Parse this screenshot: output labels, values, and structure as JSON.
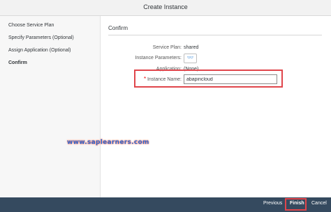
{
  "window": {
    "title": "Create Instance",
    "top_glyph": "¨"
  },
  "sidebar": {
    "steps": [
      {
        "label": "Choose Service Plan",
        "active": false
      },
      {
        "label": "Specify Parameters (Optional)",
        "active": false
      },
      {
        "label": "Assign Application (Optional)",
        "active": false
      },
      {
        "label": "Confirm",
        "active": true
      }
    ]
  },
  "main": {
    "section_title": "Confirm",
    "fields": {
      "service_plan": {
        "label": "Service Plan:",
        "value": "shared"
      },
      "instance_parameters": {
        "label": "Instance Parameters:",
        "icon": "glasses-icon"
      },
      "application": {
        "label": "Application:",
        "value": "(None)"
      },
      "instance_name": {
        "required_mark": "*",
        "label": "Instance Name:",
        "value": "abapincloud"
      }
    }
  },
  "watermark": "www.saplearners.com",
  "footer": {
    "previous": "Previous",
    "finish": "Finish",
    "cancel": "Cancel"
  },
  "colors": {
    "footer_bg": "#354a5f",
    "highlight": "#e0454b",
    "accent": "#0a6ed1",
    "watermark": "#2d6fd6"
  }
}
